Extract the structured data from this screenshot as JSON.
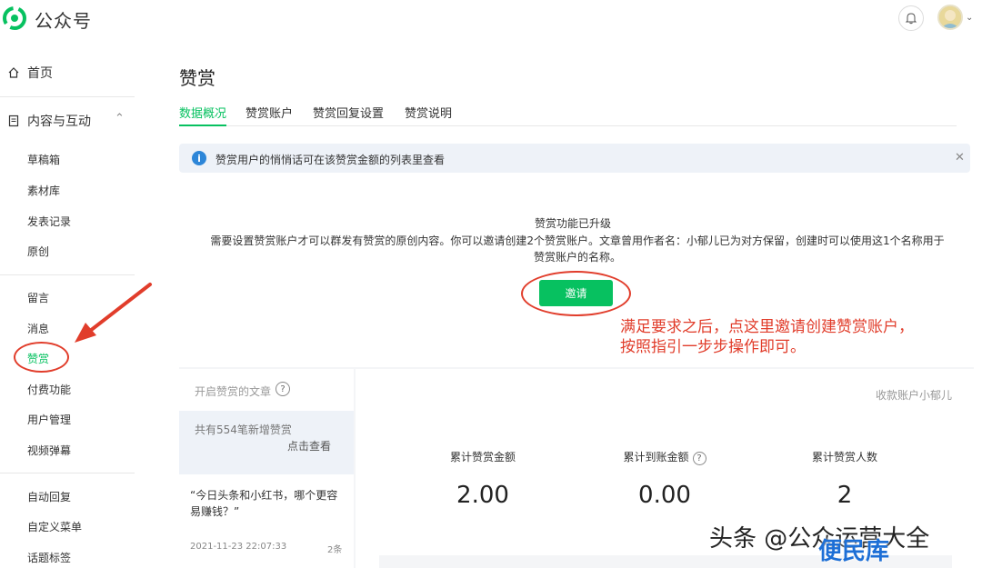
{
  "brand": {
    "name": "公众号",
    "logo_icon": "wechat-official-accounts-logo"
  },
  "header": {
    "bell_icon": "bell-icon",
    "avatar_icon": "avatar"
  },
  "sidebar": {
    "home": "首页",
    "content_group": "内容与互动",
    "items_a": [
      "草稿箱",
      "素材库",
      "发表记录",
      "原创"
    ],
    "items_b": [
      "留言",
      "消息",
      "赞赏",
      "付费功能",
      "用户管理",
      "视频弹幕"
    ],
    "items_c": [
      "自动回复",
      "自定义菜单",
      "话题标签"
    ],
    "active": "赞赏",
    "accent": "#07c160"
  },
  "main": {
    "title": "赞赏",
    "tabs": [
      "数据概况",
      "赞赏账户",
      "赞赏回复设置",
      "赞赏说明"
    ],
    "notice": "赞赏用户的悄悄话可在该赞赏金额的列表里查看",
    "upgrade_title": "赞赏功能已升级",
    "upgrade_desc": "需要设置赞赏账户才可以群发有赞赏的原创内容。你可以邀请创建2个赞赏账户。文章曾用作者名：小郁儿已为对方保留，创建时可以使用这1个名称用于赞赏账户的名称。",
    "invite_button": "邀请",
    "annotation_line1": "满足要求之后，点这里邀请创建赞赏账户，",
    "annotation_line2": "按照指引一步步操作即可。",
    "annotation_color": "#e13d2b"
  },
  "articles": {
    "header": "开启赞赏的文章",
    "new_summary": "共有554笔新增赞赏",
    "view_link": "点击查看",
    "item_title": "“今日头条和小红书，哪个更容易赚钱？”",
    "item_time": "2021-11-23 22:07:33",
    "item_count": "2条"
  },
  "stats": {
    "account_label": "收款账户小郁儿",
    "labels": [
      "累计赞赏金额",
      "累计到账金额",
      "累计赞赏人数"
    ],
    "values": [
      "2.00",
      "0.00",
      "2"
    ]
  },
  "watermark": {
    "text": "头条 @公众运营大全",
    "overlay": "便民库"
  }
}
